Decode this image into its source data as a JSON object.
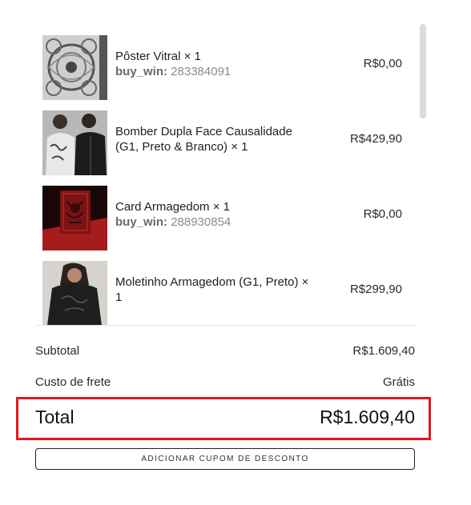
{
  "cart": {
    "items": [
      {
        "name": "Pôster Vitral × 1",
        "meta_key": "buy_win:",
        "meta_value": "283384091",
        "price": "R$0,00",
        "image": "poster-vitral-thumbnail"
      },
      {
        "name": "Bomber Dupla Face Causalidade (G1, Preto & Branco) × 1",
        "meta_key": "",
        "meta_value": "",
        "price": "R$429,90",
        "image": "bomber-jacket-thumbnail"
      },
      {
        "name": "Card Armagedom × 1",
        "meta_key": "buy_win:",
        "meta_value": "288930854",
        "price": "R$0,00",
        "image": "card-armagedom-thumbnail"
      },
      {
        "name": "Moletinho Armagedom (G1, Preto) × 1",
        "meta_key": "",
        "meta_value": "",
        "price": "R$299,90",
        "image": "moletinho-thumbnail"
      }
    ]
  },
  "summary": {
    "subtotal_label": "Subtotal",
    "subtotal_value": "R$1.609,40",
    "shipping_label": "Custo de frete",
    "shipping_value": "Grátis",
    "total_label": "Total",
    "total_value": "R$1.609,40",
    "highlight_color": "#e3171d"
  },
  "coupon_button": {
    "label": "ADICIONAR CUPOM DE DESCONTO"
  }
}
